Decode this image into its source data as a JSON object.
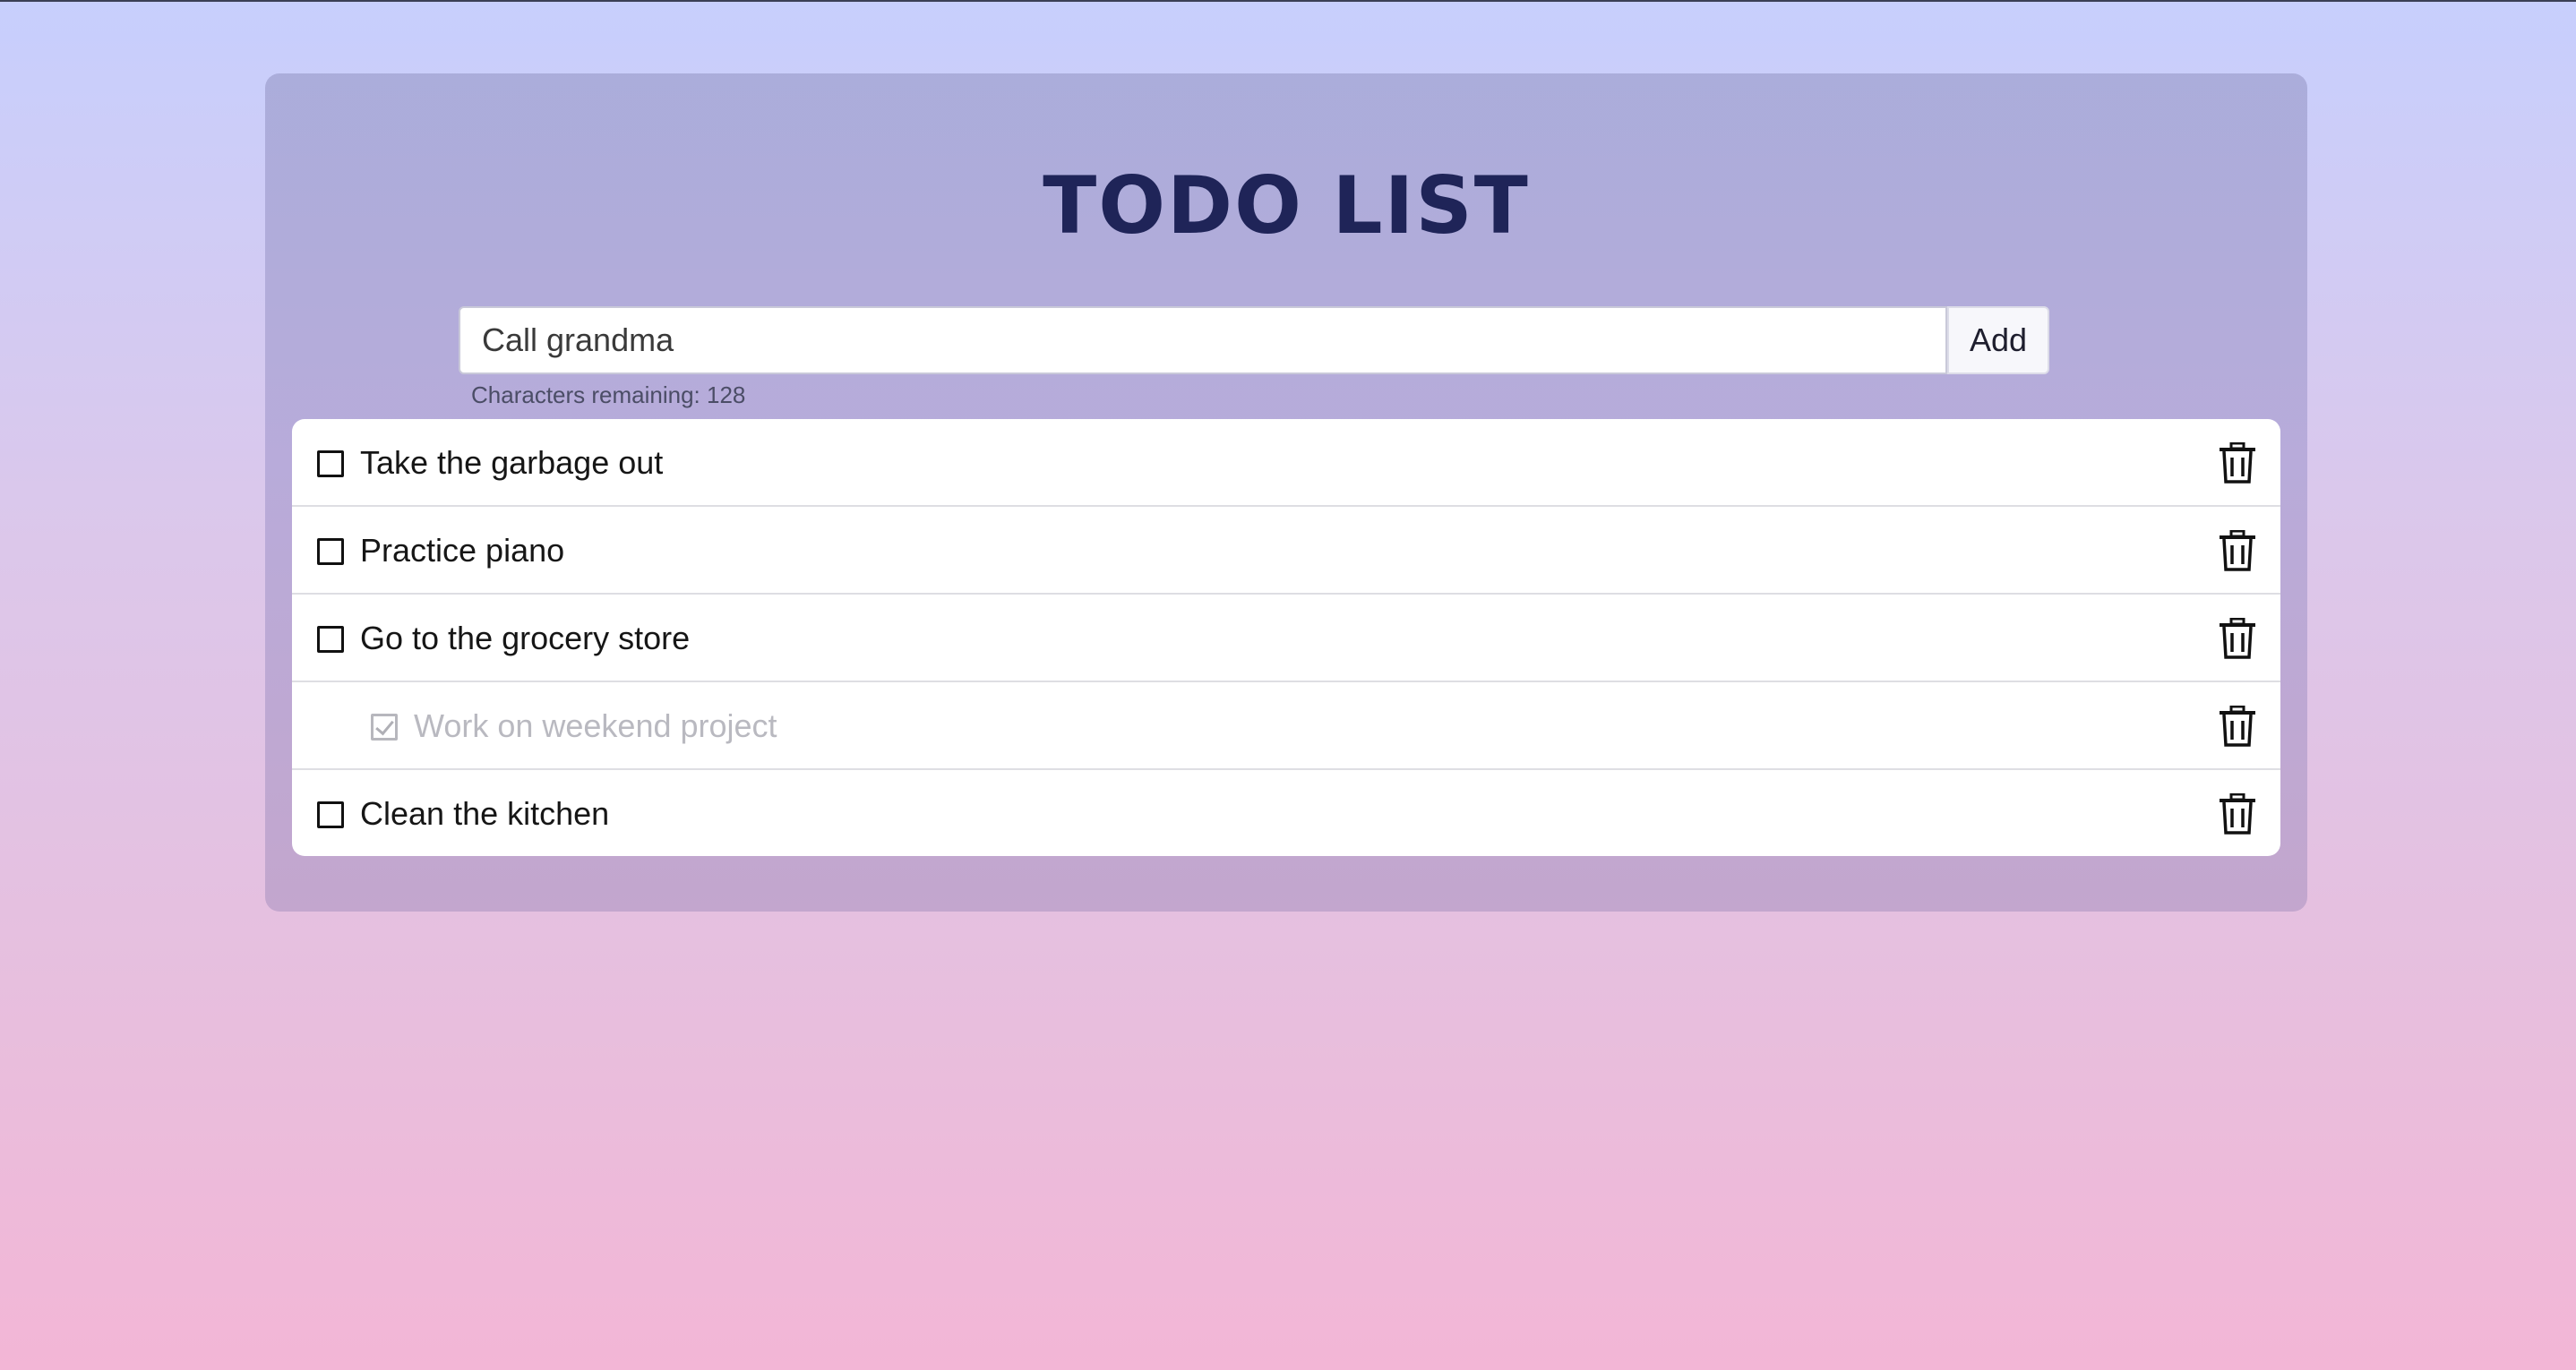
{
  "app": {
    "title": "TODO LIST"
  },
  "form": {
    "input_value": "Call grandma",
    "add_label": "Add",
    "chars_remaining": "Characters remaining: 128"
  },
  "todos": [
    {
      "text": "Take the garbage out",
      "completed": false
    },
    {
      "text": "Practice piano",
      "completed": false
    },
    {
      "text": "Go to the grocery store",
      "completed": false
    },
    {
      "text": "Work on weekend project",
      "completed": true
    },
    {
      "text": "Clean the kitchen",
      "completed": false
    }
  ],
  "icons": {
    "delete": "trash-icon",
    "checkbox": "checkbox-icon"
  },
  "colors": {
    "title": "#1f2458",
    "completed_text": "#b9b9c0",
    "gradient_top": "#c7cffd",
    "gradient_bottom": "#f3b6d6"
  }
}
